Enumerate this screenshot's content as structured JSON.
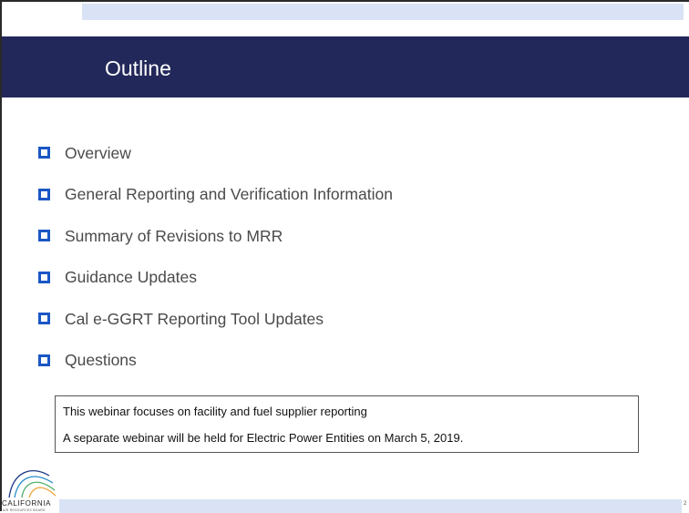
{
  "slide": {
    "title": "Outline",
    "bullets": [
      "Overview",
      "General Reporting and Verification Information",
      "Summary of Revisions to MRR",
      "Guidance Updates",
      "Cal e-GGRT Reporting Tool Updates",
      "Questions"
    ],
    "note": {
      "line1": "This webinar focuses on facility and fuel supplier reporting",
      "line2": "A separate webinar will be held for Electric Power Entities on March 5, 2019."
    },
    "logo": {
      "name": "CALIFORNIA",
      "subtitle": "AIR RESOURCES BOARD"
    },
    "page_number": "2"
  },
  "colors": {
    "title_bar": "#23285a",
    "accent_strip": "#d9e3f5",
    "bullet": "#1b57c4"
  }
}
